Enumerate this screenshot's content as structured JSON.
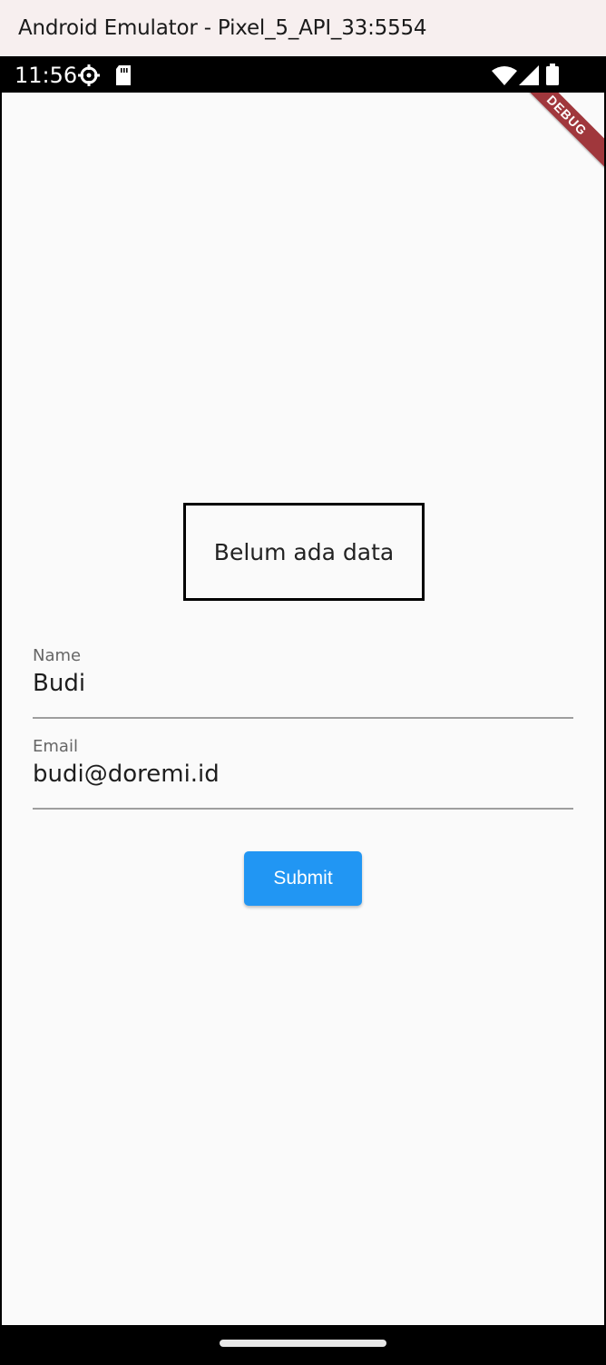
{
  "window": {
    "title": "Android Emulator - Pixel_5_API_33:5554"
  },
  "status_bar": {
    "time": "11:56",
    "icons": [
      "settings-gear-icon",
      "sd-card-icon",
      "wifi-icon",
      "cell-signal-icon",
      "battery-icon"
    ]
  },
  "debug_banner": {
    "label": "DEBUG",
    "color": "#a0373c"
  },
  "data_box": {
    "text": "Belum ada data"
  },
  "form": {
    "name_field": {
      "label": "Name",
      "value": "Budi"
    },
    "email_field": {
      "label": "Email",
      "value": "budi@doremi.id"
    },
    "submit_label": "Submit",
    "accent_color": "#2196f3"
  }
}
